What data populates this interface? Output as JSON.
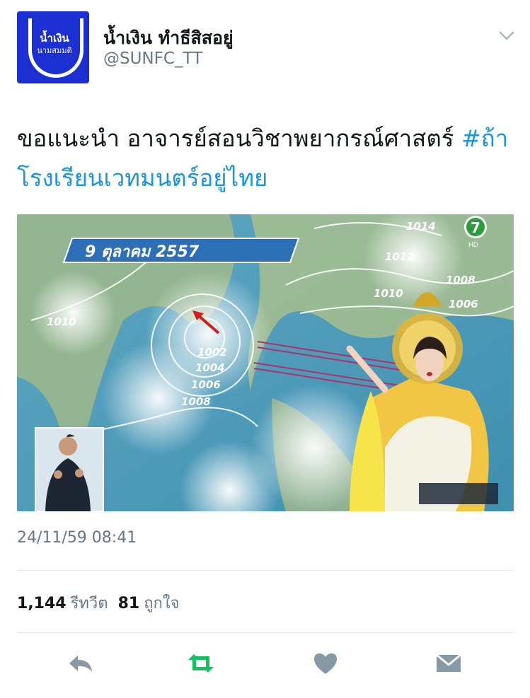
{
  "user": {
    "display_name": "น้ำเงิน ทำธีสิสอยู่",
    "handle": "@SUNFC_TT",
    "avatar_text_line1": "น้ำเงิน",
    "avatar_text_line2": "นามสมมติ"
  },
  "tweet": {
    "text_plain": "ขอแนะนำ อาจารย์สอนวิชาพยากรณ์ศาสตร์ ",
    "hashtag": "#ถ้าโรงเรียนเวทมนตร์อยู่ไทย",
    "timestamp": "24/11/59 08:41"
  },
  "media": {
    "date_banner": "9 ตุลาคม 2557",
    "channel_logo": "7",
    "channel_sub": "HD",
    "pressure_labels": [
      "1014",
      "1012",
      "1010",
      "1008",
      "1006",
      "1010",
      "1002",
      "1004",
      "1006",
      "1008"
    ]
  },
  "stats": {
    "retweets_count": "1,144",
    "retweets_label": "รีทวีต",
    "likes_count": "81",
    "likes_label": "ถูกใจ"
  },
  "actions": {
    "reply_icon": "reply-icon",
    "retweet_icon": "retweet-icon",
    "like_icon": "heart-icon",
    "dm_icon": "envelope-icon"
  },
  "colors": {
    "avatar_bg": "#1c2fd0",
    "hashtag": "#1b95e0",
    "retweet_active": "#17bf63",
    "muted": "#657786"
  }
}
